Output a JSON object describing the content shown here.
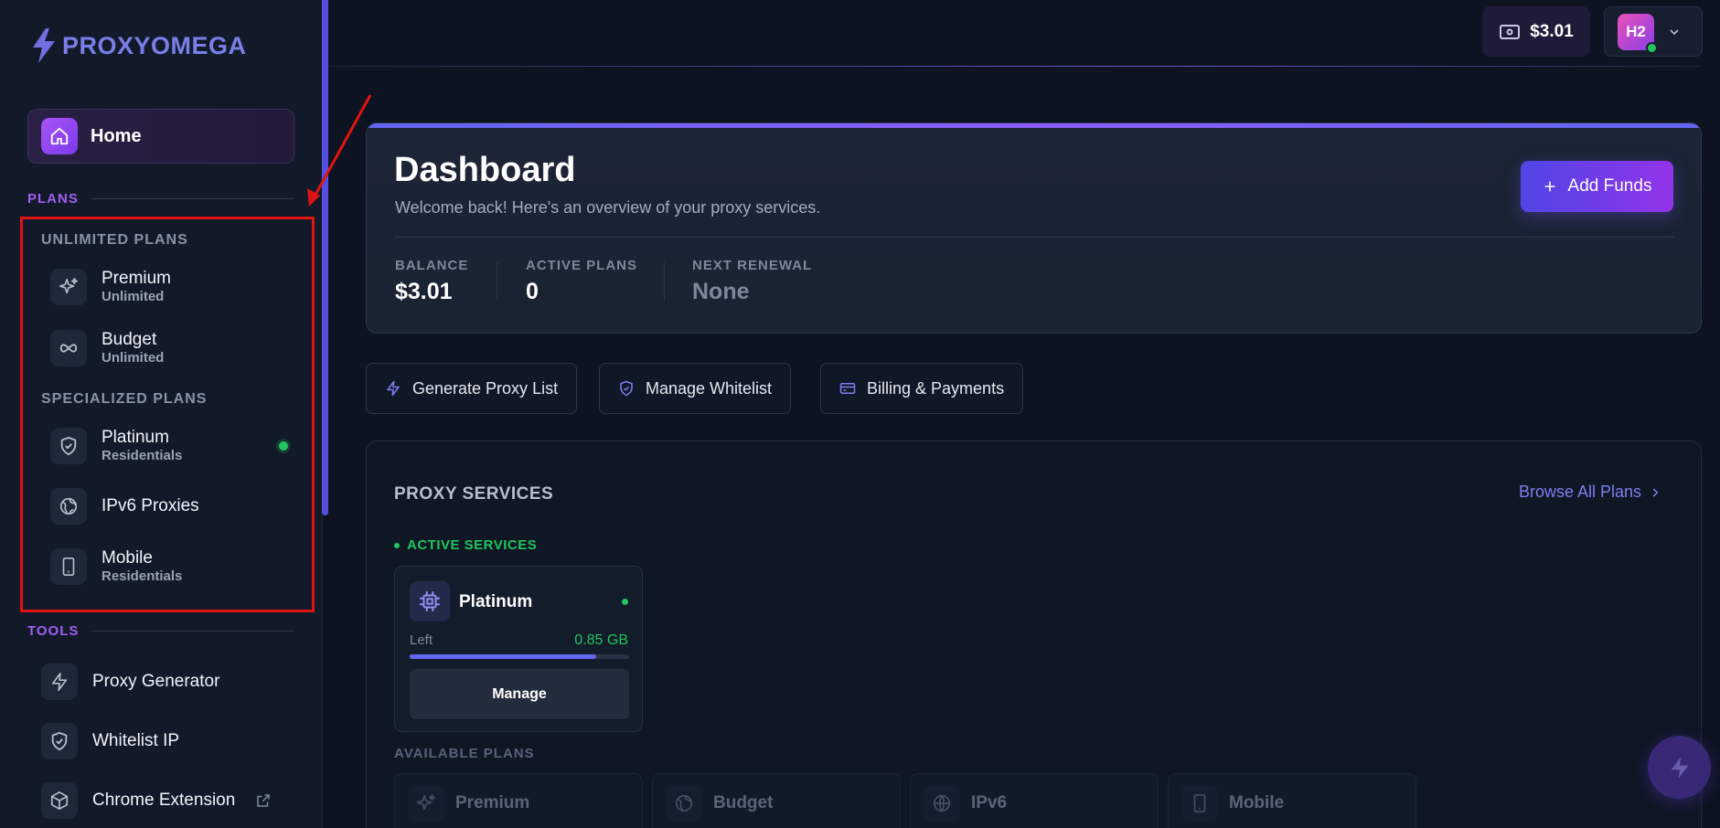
{
  "brand": {
    "name": "PROXYOMEGA"
  },
  "sidebar": {
    "home_label": "Home",
    "plans_section": "PLANS",
    "unlimited_group": "UNLIMITED PLANS",
    "specialized_group": "SPECIALIZED PLANS",
    "plans": [
      {
        "name": "Premium",
        "sub": "Unlimited",
        "icon": "sparkles-icon"
      },
      {
        "name": "Budget",
        "sub": "Unlimited",
        "icon": "infinity-icon"
      },
      {
        "name": "Platinum",
        "sub": "Residentials",
        "icon": "shield-check-icon",
        "active": true
      },
      {
        "name": "IPv6 Proxies",
        "sub": "",
        "icon": "globe-icon"
      },
      {
        "name": "Mobile",
        "sub": "Residentials",
        "icon": "smartphone-icon"
      }
    ],
    "tools_section": "TOOLS",
    "tools": [
      {
        "label": "Proxy Generator",
        "icon": "bolt-icon"
      },
      {
        "label": "Whitelist IP",
        "icon": "shield-check-icon"
      },
      {
        "label": "Chrome Extension",
        "icon": "box-icon",
        "external": true
      }
    ]
  },
  "topbar": {
    "balance": "$3.01",
    "user_initials": "H2"
  },
  "dashboard": {
    "title": "Dashboard",
    "subtitle": "Welcome back! Here's an overview of your proxy services.",
    "add_funds_label": "Add Funds",
    "stats": [
      {
        "label": "BALANCE",
        "value": "$3.01"
      },
      {
        "label": "ACTIVE PLANS",
        "value": "0"
      },
      {
        "label": "NEXT RENEWAL",
        "value": "None"
      }
    ]
  },
  "quick_actions": [
    {
      "label": "Generate Proxy List",
      "icon": "bolt-icon"
    },
    {
      "label": "Manage Whitelist",
      "icon": "shield-check-icon"
    },
    {
      "label": "Billing & Payments",
      "icon": "credit-card-icon"
    }
  ],
  "services": {
    "title": "PROXY SERVICES",
    "browse_label": "Browse All Plans",
    "active_heading": "ACTIVE SERVICES",
    "active_card": {
      "name": "Platinum",
      "left_label": "Left",
      "left_value": "0.85 GB",
      "usage_fraction": 0.85,
      "manage_label": "Manage"
    },
    "available_heading": "AVAILABLE PLANS",
    "available": [
      {
        "label": "Premium",
        "icon": "sparkles-icon"
      },
      {
        "label": "Budget",
        "icon": "globe-icon"
      },
      {
        "label": "IPv6",
        "icon": "globe-icon"
      },
      {
        "label": "Mobile",
        "icon": "smartphone-icon"
      }
    ]
  },
  "colors": {
    "accent": "#6366f1",
    "purple": "#a855f7",
    "success": "#22c55e",
    "highlight_box": "#e01313"
  }
}
